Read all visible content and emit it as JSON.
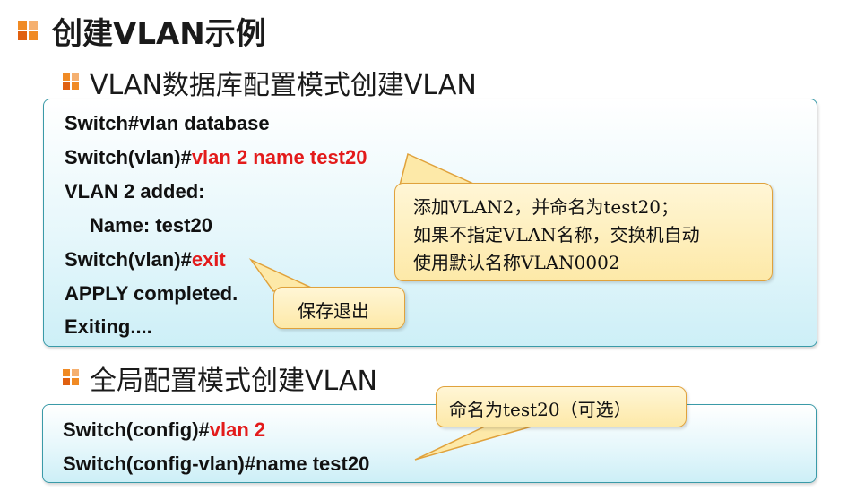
{
  "title": "创建VLAN示例",
  "section1": {
    "heading": "VLAN数据库配置模式创建VLAN",
    "lines": {
      "l1": "Switch#vlan database",
      "l2_prefix": "Switch(vlan)#",
      "l2_cmd": "vlan 2 name test20",
      "l3": "VLAN 2 added:",
      "l4": "Name: test20",
      "l5_prefix": "Switch(vlan)#",
      "l5_cmd": "exit",
      "l6": "APPLY completed.",
      "l7": "Exiting...."
    },
    "callout_main": [
      "添加VLAN2，并命名为test20；",
      "如果不指定VLAN名称，交换机自动",
      "使用默认名称VLAN0002"
    ],
    "callout_exit": "保存退出"
  },
  "section2": {
    "heading": "全局配置模式创建VLAN",
    "lines": {
      "l1_prefix": "Switch(config)#",
      "l1_cmd": "vlan 2",
      "l2": "Switch(config-vlan)#name test20"
    },
    "callout": "命名为test20（可选）"
  },
  "colors": {
    "accent_orange": "#f08a24",
    "command_red": "#e31b1b",
    "box_border": "#3a9aa8",
    "callout_border": "#e0a23c"
  }
}
